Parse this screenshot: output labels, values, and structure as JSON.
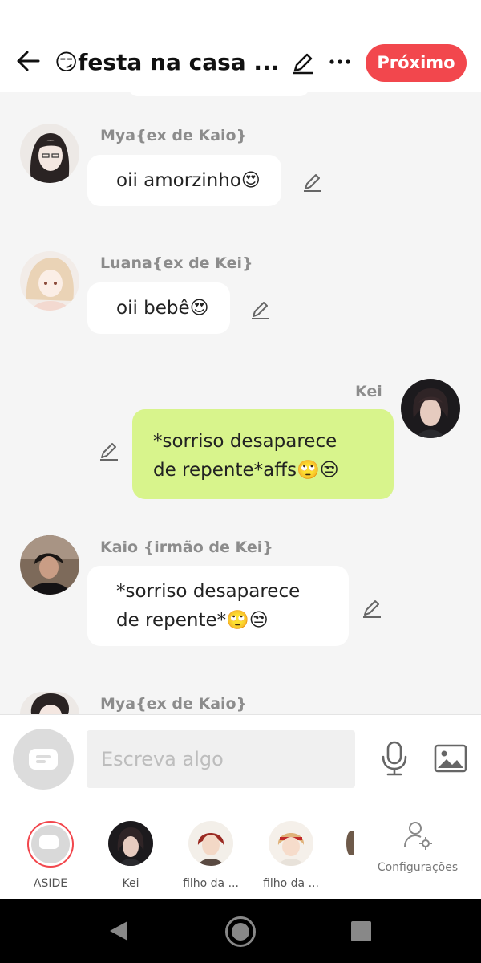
{
  "header": {
    "title": "😏festa na casa ...",
    "next_label": "Próximo"
  },
  "messages": [
    {
      "sender": "Mya{ex de Kaio}",
      "lines": [
        "oii amorzinho😍"
      ]
    },
    {
      "sender": "Luana{ex de Kei}",
      "lines": [
        "oii bebê😍"
      ]
    },
    {
      "sender": "Kei",
      "lines": [
        "*sorriso desaparece",
        "de repente*affs🙄😒"
      ]
    },
    {
      "sender": "Kaio {irmão de Kei}",
      "lines": [
        "*sorriso desaparece",
        "de repente*🙄😒"
      ]
    },
    {
      "sender": "Mya{ex de Kaio}",
      "lines": []
    }
  ],
  "composer": {
    "placeholder": "Escreva algo"
  },
  "characters": [
    {
      "label": "ASIDE"
    },
    {
      "label": "Kei"
    },
    {
      "label": "filho da ..."
    },
    {
      "label": "filho da ..."
    }
  ],
  "settings": {
    "label": "Configurações"
  },
  "icons": {
    "back": "arrow-left-icon",
    "edit": "pencil-icon",
    "more": "more-dots-icon",
    "mic": "microphone-icon",
    "image": "image-icon",
    "settings": "user-gear-icon"
  },
  "colors": {
    "accent": "#f2474d",
    "self_bubble": "#d8f48c",
    "other_bubble": "#ffffff",
    "background": "#f5f5f5"
  }
}
